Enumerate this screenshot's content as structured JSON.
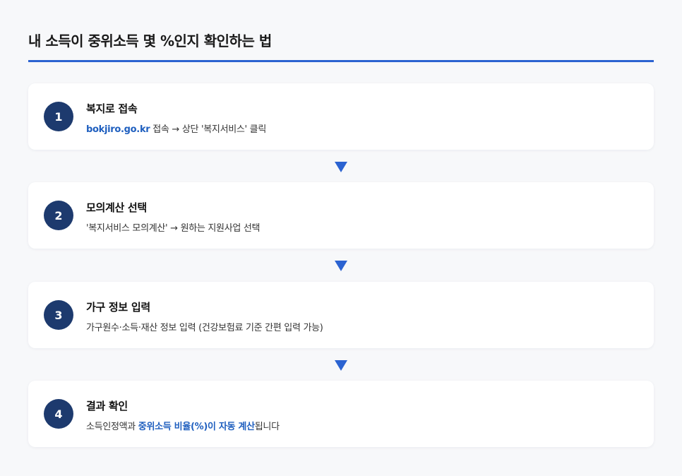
{
  "page": {
    "title": "내 소득이 중위소득 몇 %인지 확인하는 법"
  },
  "colors": {
    "accent": "#2b63d1",
    "badge": "#1d3a6e",
    "highlight": "#1f5fbf",
    "background": "#f7f8fa"
  },
  "steps": [
    {
      "number": "1",
      "title": "복지로 접속",
      "desc_highlight": "bokjiro.go.kr",
      "desc_rest": " 접속 → 상단 '복지서비스' 클릭"
    },
    {
      "number": "2",
      "title": "모의계산 선택",
      "desc": "'복지서비스 모의계산' → 원하는 지원사업 선택"
    },
    {
      "number": "3",
      "title": "가구 정보 입력",
      "desc": "가구원수·소득·재산 정보 입력 (건강보험료 기준 간편 입력 가능)"
    },
    {
      "number": "4",
      "title": "결과 확인",
      "desc_before": "소득인정액과 ",
      "desc_highlight": "중위소득 비율(%)이 자동 계산",
      "desc_after": "됩니다"
    }
  ],
  "icons": {
    "connector": "arrow-down-icon"
  }
}
